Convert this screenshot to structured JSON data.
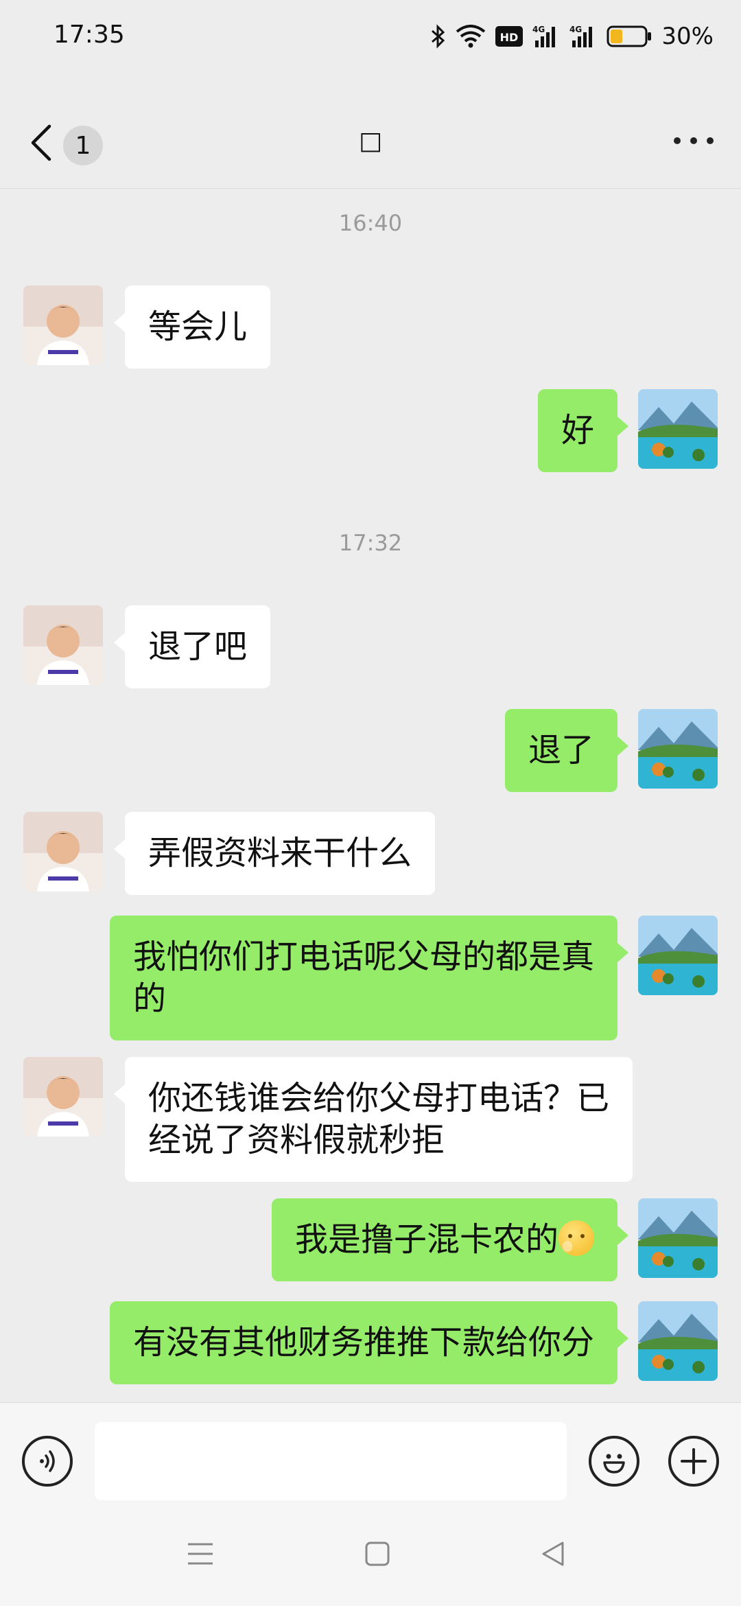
{
  "status_bar": {
    "time": "17:35",
    "icons": [
      "bluetooth-icon",
      "wifi-icon",
      "hd-icon",
      "signal-4g-icon",
      "signal-4g-icon",
      "battery-icon"
    ],
    "battery_percent": "30%"
  },
  "header": {
    "back_label": "",
    "unread_count": "1",
    "title": "□",
    "more_icon": "more-dots-icon"
  },
  "timestamps": [
    "16:40",
    "17:32"
  ],
  "messages": [
    {
      "side": "in",
      "text": "等会儿"
    },
    {
      "side": "out",
      "text": "好"
    },
    {
      "side": "in",
      "text": "退了吧"
    },
    {
      "side": "out",
      "text": "退了"
    },
    {
      "side": "in",
      "text": "弄假资料来干什么"
    },
    {
      "side": "out",
      "text": "我怕你们打电话呢父母的都是真的"
    },
    {
      "side": "in",
      "text": "你还钱谁会给你父母打电话？已经说了资料假就秒拒"
    },
    {
      "side": "out",
      "text": "我是撸子混卡农的",
      "emoji": "thinking-face-emoji"
    },
    {
      "side": "out",
      "text": "有没有其他财务推推下款给你分"
    }
  ],
  "input": {
    "value": "",
    "voice_icon": "voice-icon",
    "emoji_icon": "emoji-icon",
    "plus_icon": "plus-icon"
  },
  "colors": {
    "background": "#ededed",
    "incoming_bubble": "#ffffff",
    "outgoing_bubble": "#95ec69",
    "timestamp": "#9a9a9a"
  }
}
